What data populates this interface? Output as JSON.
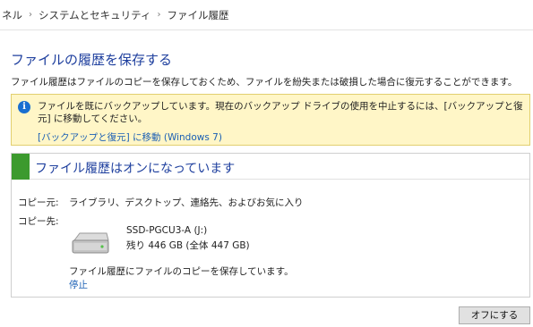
{
  "breadcrumb": {
    "items": [
      "ネル",
      "システムとセキュリティ",
      "ファイル履歴"
    ],
    "separator": "›"
  },
  "page": {
    "title": "ファイルの履歴を保存する",
    "description": "ファイル履歴はファイルのコピーを保存しておくため、ファイルを紛失または破損した場合に復元することができます。"
  },
  "info_bar": {
    "icon": "info-icon",
    "icon_glyph": "i",
    "message": "ファイルを既にバックアップしています。現在のバックアップ ドライブの使用を中止するには、[バックアップと復元] に移動してください。",
    "link": "[バックアップと復元] に移動 (Windows 7)",
    "background": "#fff6c7"
  },
  "status": {
    "title": "ファイル履歴はオンになっています",
    "indicator_color": "#3c9a2e",
    "copy_from_label": "コピー元:",
    "copy_from_value": "ライブラリ、デスクトップ、連絡先、およびお気に入り",
    "copy_to_label": "コピー先:",
    "drive_icon": "drive-icon",
    "drive_name": "SSD-PGCU3-A (J:)",
    "drive_free": "残り 446 GB (全体 447 GB)",
    "saving_text": "ファイル履歴にファイルのコピーを保存しています。",
    "stop_link": "停止"
  },
  "buttons": {
    "turn_off": "オフにする"
  },
  "colors": {
    "title_blue": "#1e3f9e",
    "link_blue": "#1a5fb4"
  }
}
